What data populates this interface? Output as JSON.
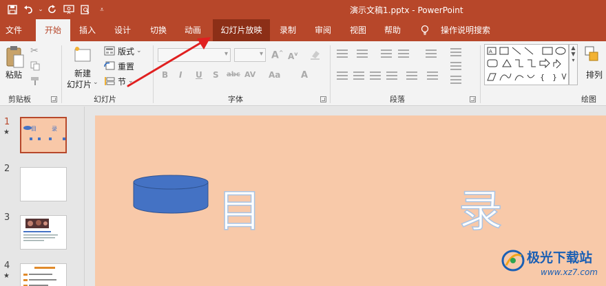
{
  "window": {
    "title": "演示文稿1.pptx  -  PowerPoint",
    "accent_color": "#b7472a"
  },
  "quick_access": {
    "icons": [
      "save-icon",
      "undo-icon",
      "redo-icon",
      "present-from-start-icon",
      "print-preview-icon",
      "customize-icon"
    ]
  },
  "tabs": [
    {
      "label": "文件"
    },
    {
      "label": "开始"
    },
    {
      "label": "插入"
    },
    {
      "label": "设计"
    },
    {
      "label": "切换"
    },
    {
      "label": "动画"
    },
    {
      "label": "幻灯片放映"
    },
    {
      "label": "录制"
    },
    {
      "label": "审阅"
    },
    {
      "label": "视图"
    },
    {
      "label": "帮助"
    },
    {
      "label": "操作说明搜索"
    }
  ],
  "ribbon": {
    "clipboard": {
      "paste_label": "粘贴",
      "group_label": "剪贴板"
    },
    "slides": {
      "new_slide_line1": "新建",
      "new_slide_line2": "幻灯片",
      "layout_label": "版式",
      "reset_label": "重置",
      "section_label": "节",
      "group_label": "幻灯片"
    },
    "font": {
      "group_label": "字体",
      "bold": "B",
      "italic": "I",
      "underline": "U",
      "shadow": "S",
      "strike": "abc",
      "spacing": "AV",
      "case": "Aa",
      "color": "A"
    },
    "paragraph": {
      "group_label": "段落"
    },
    "drawing": {
      "arrange_label": "排列",
      "group_label": "绘图"
    }
  },
  "slides": [
    {
      "number": "1",
      "has_star": true
    },
    {
      "number": "2",
      "has_star": false
    },
    {
      "number": "3",
      "has_star": false
    },
    {
      "number": "4",
      "has_star": true
    }
  ],
  "main_slide": {
    "text_left": "目",
    "text_right": "录",
    "shape_color": "#4472c4",
    "background_color": "#f8c9a9"
  },
  "watermark": {
    "text": "极光下载站",
    "url": "www.xz7.com"
  }
}
